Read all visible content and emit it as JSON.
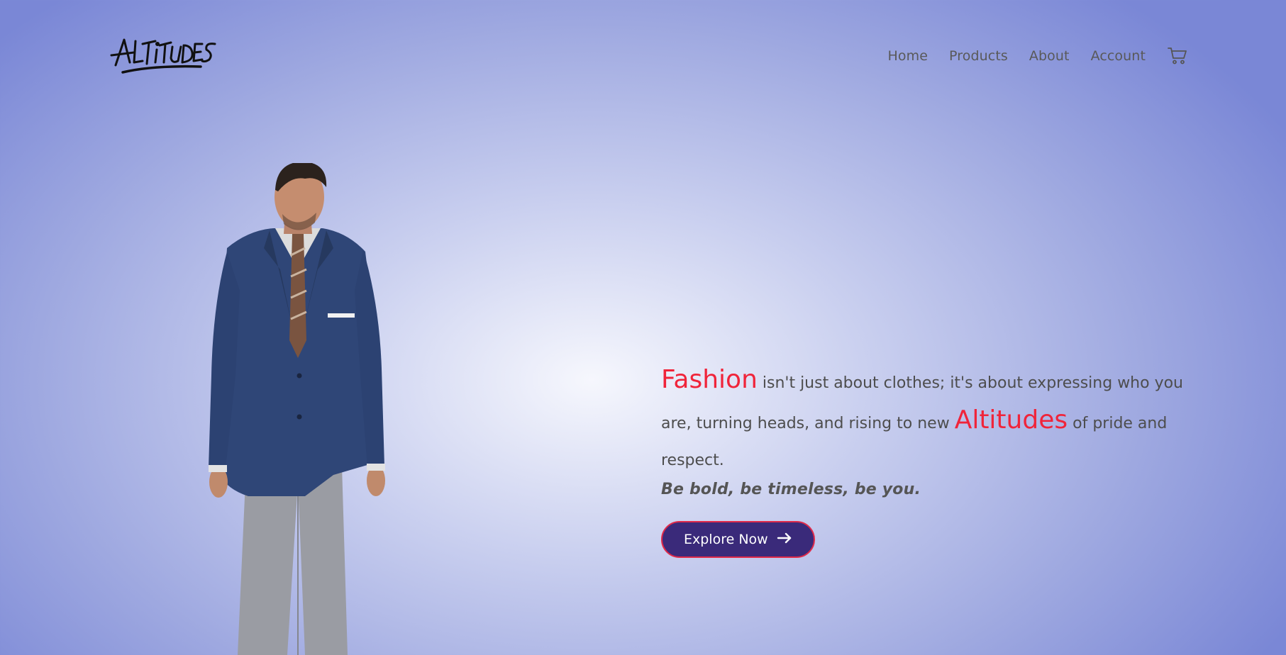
{
  "brand": {
    "logo_text": "ALTITUDES"
  },
  "nav": {
    "items": [
      {
        "label": "Home"
      },
      {
        "label": "Products"
      },
      {
        "label": "About"
      },
      {
        "label": "Account"
      }
    ],
    "cart_icon": "cart-icon"
  },
  "hero": {
    "accent_word_1": "Fashion",
    "text_part_1": " isn't just about clothes; it's about expressing who you are, turning heads, and rising to new ",
    "accent_word_2": "Altitudes",
    "text_part_2": " of pride and respect.",
    "motto": "Be bold, be timeless, be you.",
    "cta_label": "Explore Now",
    "cta_icon": "arrow-right-icon"
  },
  "colors": {
    "accent": "#f0243a",
    "button_bg": "#3a2a7a",
    "button_border": "#e02a4a",
    "bg_center": "#f6f7fd",
    "bg_edge": "#7a87d6"
  }
}
